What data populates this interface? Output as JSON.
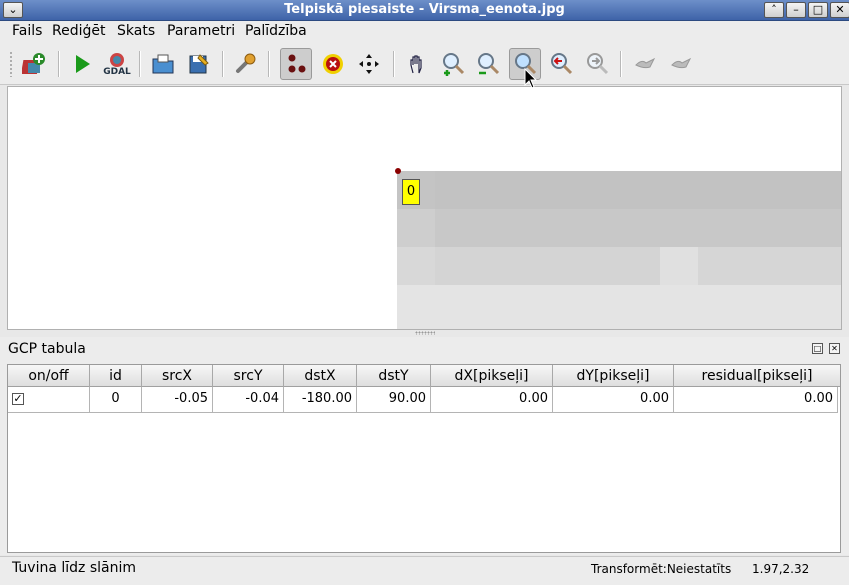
{
  "window": {
    "title": "Telpiskā piesaiste - Virsma_eenota.jpg"
  },
  "menu": [
    "Fails",
    "Rediģēt",
    "Skats",
    "Parametri",
    "Palīdzība"
  ],
  "toolbar": {
    "icons": [
      "add-raster-icon",
      "start-georef-icon",
      "gdal-script-icon",
      "open-gcp-icon",
      "save-gcp-icon",
      "settings-icon",
      "add-point-icon",
      "delete-point-icon",
      "move-point-icon",
      "pan-icon",
      "zoom-in-icon",
      "zoom-out-icon",
      "zoom-to-layer-icon",
      "zoom-last-icon",
      "zoom-next-icon",
      "link-georef-icon",
      "link-qgis-icon"
    ],
    "gdal_label": "GDAL"
  },
  "canvas": {
    "gcp_label": "0"
  },
  "gcp_table": {
    "title": "GCP tabula",
    "columns": [
      "on/off",
      "id",
      "srcX",
      "srcY",
      "dstX",
      "dstY",
      "dX[pikseļi]",
      "dY[pikseļi]",
      "residual[pikseļi]"
    ],
    "rows": [
      {
        "checked": "✓",
        "id": "0",
        "srcX": "-0.05",
        "srcY": "-0.04",
        "dstX": "-180.00",
        "dstY": "90.00",
        "dX": "0.00",
        "dY": "0.00",
        "residual": "0.00"
      }
    ]
  },
  "status": {
    "message": "Tuvina līdz slānim",
    "transform": "Transformēt:Neiestatīts",
    "coords": "1.97,2.32"
  },
  "colors": {
    "gcp_label_bg": "#ffff00",
    "titlebar": "#4a6fb3"
  }
}
